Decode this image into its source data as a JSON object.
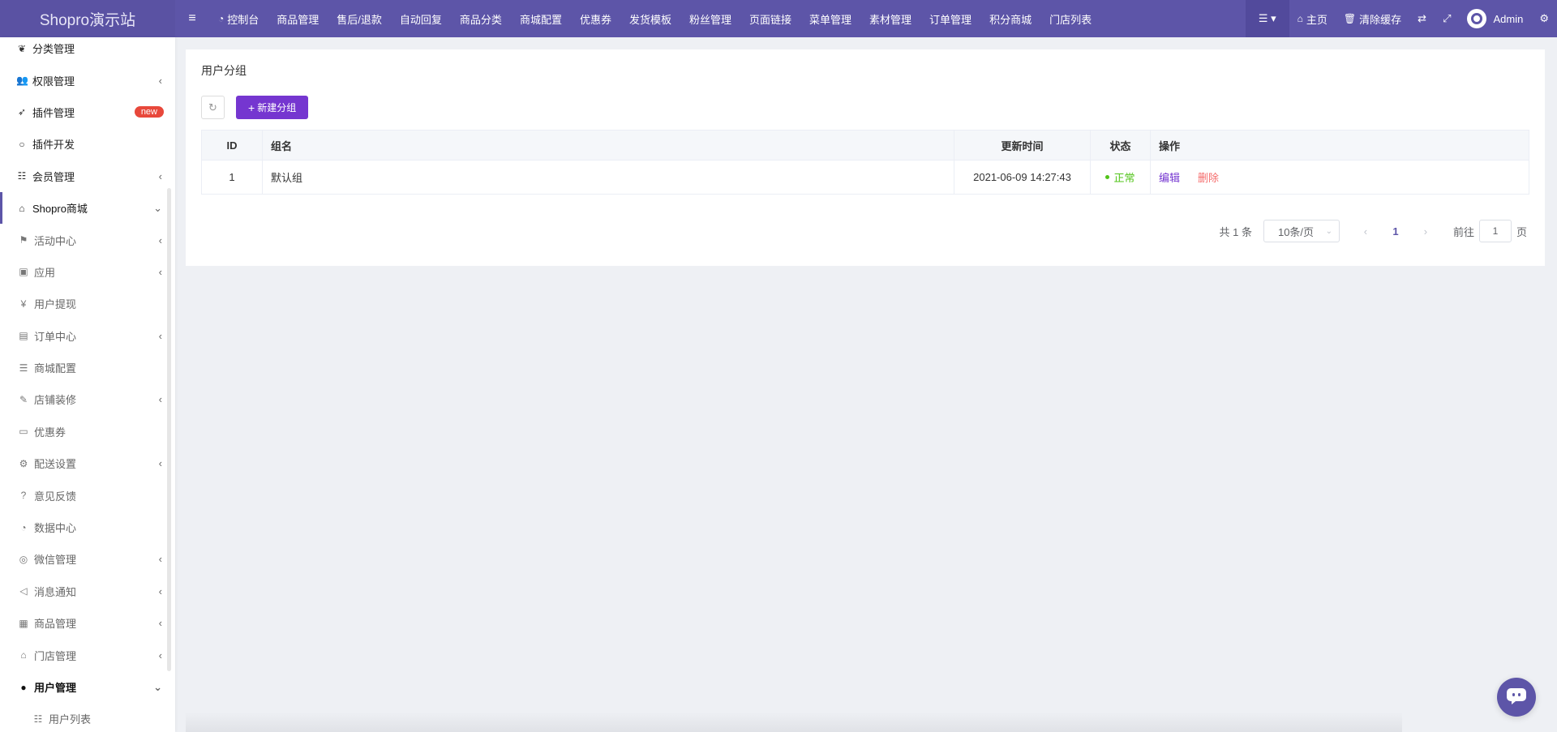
{
  "app": {
    "logo": "Shopro演示站"
  },
  "topnav": [
    {
      "label": "控制台",
      "icon": "dashboard-icon"
    },
    {
      "label": "商品管理"
    },
    {
      "label": "售后/退款"
    },
    {
      "label": "自动回复"
    },
    {
      "label": "商品分类"
    },
    {
      "label": "商城配置"
    },
    {
      "label": "优惠券"
    },
    {
      "label": "发货模板"
    },
    {
      "label": "粉丝管理"
    },
    {
      "label": "页面链接"
    },
    {
      "label": "菜单管理"
    },
    {
      "label": "素材管理"
    },
    {
      "label": "订单管理"
    },
    {
      "label": "积分商城"
    },
    {
      "label": "门店列表"
    }
  ],
  "topright": {
    "home": "主页",
    "clear_cache": "清除缓存",
    "user": "Admin"
  },
  "sidebar": {
    "items": [
      {
        "label": "分类管理",
        "icon": "leaf-icon"
      },
      {
        "label": "权限管理",
        "icon": "users-icon",
        "arrow": "‹"
      },
      {
        "label": "插件管理",
        "icon": "rocket-icon",
        "badge": "new"
      },
      {
        "label": "插件开发",
        "icon": "circle-icon"
      },
      {
        "label": "会员管理",
        "icon": "list-icon",
        "arrow": "‹"
      },
      {
        "label": "Shopro商城",
        "icon": "home-icon",
        "arrow": "⌄"
      },
      {
        "label": "活动中心",
        "icon": "flag-icon",
        "arrow": "‹"
      },
      {
        "label": "应用",
        "icon": "briefcase-icon",
        "arrow": "‹"
      },
      {
        "label": "用户提现",
        "icon": "yen-icon"
      },
      {
        "label": "订单中心",
        "icon": "file-icon",
        "arrow": "‹"
      },
      {
        "label": "商城配置",
        "icon": "sliders-icon"
      },
      {
        "label": "店铺装修",
        "icon": "brush-icon",
        "arrow": "‹"
      },
      {
        "label": "优惠券",
        "icon": "ticket-icon"
      },
      {
        "label": "配送设置",
        "icon": "cogs-icon",
        "arrow": "‹"
      },
      {
        "label": "意见反馈",
        "icon": "question-icon"
      },
      {
        "label": "数据中心",
        "icon": "gauge-icon"
      },
      {
        "label": "微信管理",
        "icon": "wechat-icon",
        "arrow": "‹"
      },
      {
        "label": "消息通知",
        "icon": "bullhorn-icon",
        "arrow": "‹"
      },
      {
        "label": "商品管理",
        "icon": "archive-icon",
        "arrow": "‹"
      },
      {
        "label": "门店管理",
        "icon": "bank-icon",
        "arrow": "‹"
      },
      {
        "label": "用户管理",
        "icon": "user-icon",
        "arrow": "⌄"
      },
      {
        "label": "用户列表",
        "icon": "list-icon"
      }
    ]
  },
  "page": {
    "title": "用户分组",
    "add_button": "新建分组"
  },
  "table": {
    "headers": {
      "id": "ID",
      "name": "组名",
      "time": "更新时间",
      "status": "状态",
      "op": "操作"
    },
    "rows": [
      {
        "id": "1",
        "name": "默认组",
        "time": "2021-06-09 14:27:43",
        "status": "正常",
        "edit": "编辑",
        "delete": "删除"
      }
    ]
  },
  "pager": {
    "total": "共 1 条",
    "size": "10条/页",
    "page": "1",
    "goto_prefix": "前往",
    "goto_value": "1",
    "goto_suffix": "页"
  },
  "colors": {
    "brand": "#5d55a8",
    "accent": "#7536d0",
    "success": "#52c41a",
    "danger": "#f56c6c"
  }
}
